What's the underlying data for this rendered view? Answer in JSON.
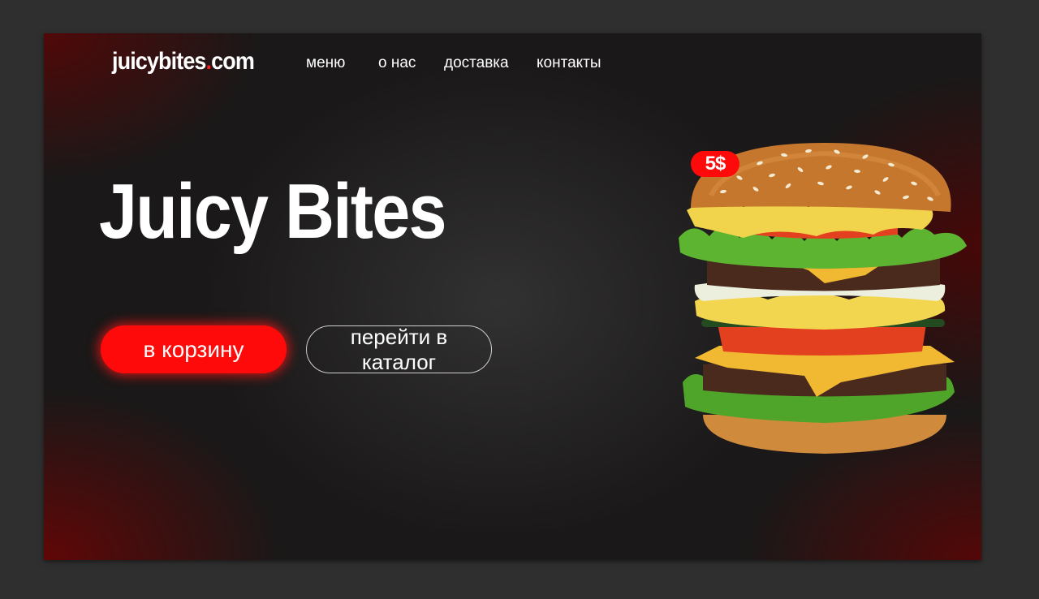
{
  "header": {
    "logo_text": "juicybites",
    "logo_dot": ".",
    "logo_suffix": "com",
    "nav": [
      "меню",
      "о нас",
      "доставка",
      "контакты"
    ]
  },
  "hero": {
    "title": "Juicy Bites",
    "cart_button": "в корзину",
    "catalog_button": "перейти в каталог"
  },
  "product": {
    "price": "5$",
    "image": "burger-image"
  },
  "colors": {
    "accent": "#ff0a0a",
    "background": "#1a1818",
    "text": "#ffffff"
  }
}
